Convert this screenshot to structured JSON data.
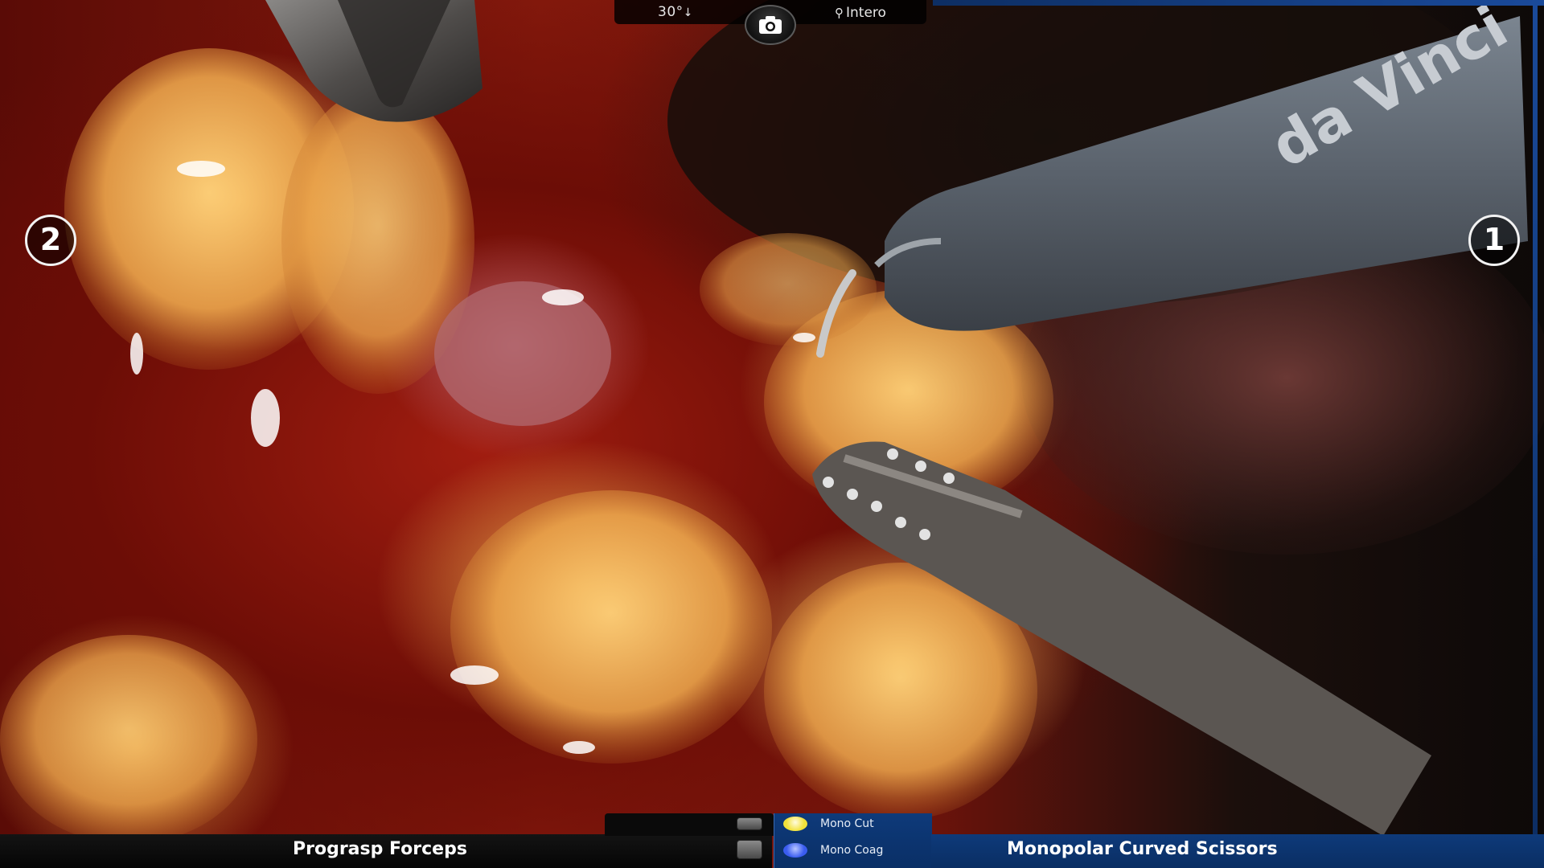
{
  "top_hud": {
    "scope_angle": "30°",
    "scope_direction_glyph": "↓",
    "camera_icon": "camera-icon",
    "mode_label": "Intero",
    "mode_icon_glyph": "⚲"
  },
  "arms": {
    "left_arm_number": "2",
    "right_arm_number": "1"
  },
  "bottom_hud": {
    "left_instrument": "Prograsp Forceps",
    "right_instrument": "Monopolar Curved Scissors",
    "energy_modes": [
      {
        "label": "Mono Cut",
        "color": "#f2e23a"
      },
      {
        "label": "Mono Coag",
        "color": "#3a5cf0"
      }
    ]
  },
  "overlay_text": {
    "instrument_shaft_brand": "da Vinci"
  },
  "colors": {
    "hud_blue": "#0e3a7a",
    "hud_dark": "#0a0a0a",
    "badge_border": "#f2f2f2"
  }
}
